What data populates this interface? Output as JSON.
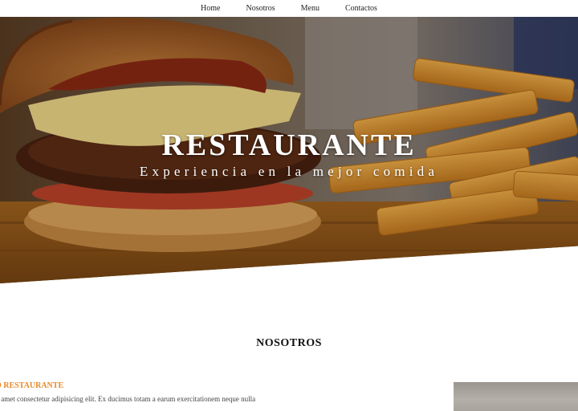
{
  "nav": {
    "items": [
      {
        "label": "Home"
      },
      {
        "label": "Nosotros"
      },
      {
        "label": "Menu"
      },
      {
        "label": "Contactos"
      }
    ]
  },
  "hero": {
    "title": "RESTAURANTE",
    "subtitle": "Experiencia en la mejor comida",
    "image_subject": "burger-and-fries"
  },
  "about": {
    "section_title": "NOSOTROS",
    "heading": "O RESTAURANTE",
    "text": "it amet consectetur adipisicing elit. Ex ducimus totam a earum exercitationem neque nulla",
    "heading_color": "#e8892b"
  }
}
